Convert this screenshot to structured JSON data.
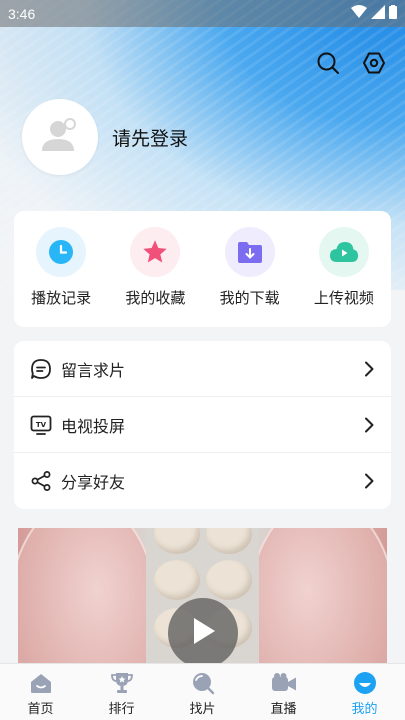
{
  "status_bar": {
    "time": "3:46"
  },
  "profile": {
    "login_prompt": "请先登录"
  },
  "quick_actions": [
    {
      "label": "播放记录",
      "icon": "clock-icon",
      "color": "#29b6f6"
    },
    {
      "label": "我的收藏",
      "icon": "star-icon",
      "color": "#f0507a"
    },
    {
      "label": "我的下载",
      "icon": "download-folder-icon",
      "color": "#7b6cf0"
    },
    {
      "label": "上传视频",
      "icon": "cloud-upload-icon",
      "color": "#2ec4a0"
    }
  ],
  "menu": [
    {
      "label": "留言求片",
      "icon": "message-icon"
    },
    {
      "label": "电视投屏",
      "icon": "tv-icon"
    },
    {
      "label": "分享好友",
      "icon": "share-icon"
    }
  ],
  "tab_bar": [
    {
      "label": "首页",
      "icon": "home-icon"
    },
    {
      "label": "排行",
      "icon": "trophy-icon"
    },
    {
      "label": "找片",
      "icon": "search-globe-icon"
    },
    {
      "label": "直播",
      "icon": "camera-icon"
    },
    {
      "label": "我的",
      "icon": "profile-icon",
      "active": true
    }
  ],
  "colors": {
    "accent": "#1da1f2",
    "hero_blue": "#1e88e5"
  }
}
